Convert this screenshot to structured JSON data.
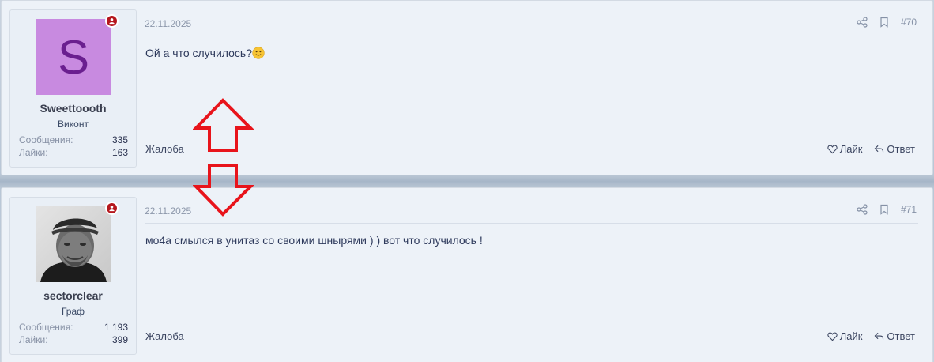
{
  "posts": [
    {
      "date": "22.11.2025",
      "number": "#70",
      "author": {
        "avatar_letter": "S",
        "avatar_color": "#c88ae0",
        "username": "Sweettoooth",
        "title": "Виконт",
        "messages_label": "Сообщения:",
        "messages": "335",
        "likes_label": "Лайки:",
        "likes": "163"
      },
      "body": "Ой а что случилось?",
      "body_emoji": "slightly-smiling-face",
      "report": "Жалоба",
      "like": "Лайк",
      "reply": "Ответ"
    },
    {
      "date": "22.11.2025",
      "number": "#71",
      "author": {
        "username": "sectorclear",
        "title": "Граф",
        "messages_label": "Сообщения:",
        "messages": "1 193",
        "likes_label": "Лайки:",
        "likes": "399"
      },
      "body": "мо4а смылся в унитаз со своими шнырями ) ) вот что случилось !",
      "report": "Жалоба",
      "like": "Лайк",
      "reply": "Ответ"
    }
  ],
  "colors": {
    "annotation_red": "#e8141b",
    "online_status": "#b5171d"
  },
  "icons": [
    "share-icon",
    "bookmark-icon",
    "heart-icon",
    "reply-icon",
    "online-status-icon"
  ]
}
